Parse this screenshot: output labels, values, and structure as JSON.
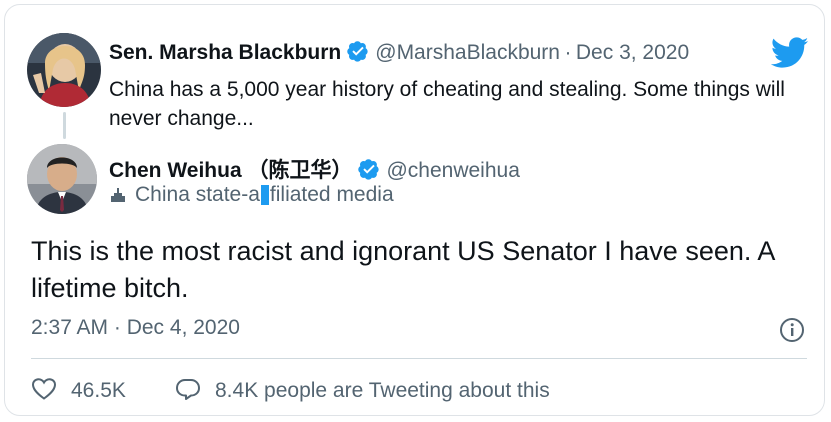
{
  "quoted_tweet": {
    "author_name": "Sen. Marsha Blackburn",
    "handle": "@MarshaBlackburn",
    "separator": "·",
    "date": "Dec 3, 2020",
    "text": "China has a 5,000 year history of cheating and stealing. Some things will never change..."
  },
  "tweet": {
    "author_name": "Chen Weihua （陈卫华）",
    "handle": "@chenweihua",
    "affiliation_before": "China state-a",
    "affiliation_after": "filiated media",
    "text": "This is the most racist and ignorant US Senator I have seen.  A lifetime bitch.",
    "timestamp": "2:37 AM · Dec 4, 2020",
    "likes": "46.5K",
    "tweeting_text": "8.4K people are Tweeting about this"
  },
  "icons": {
    "verified": "verified-badge-icon",
    "brand": "twitter-bird-icon",
    "info": "info-icon",
    "like": "heart-icon",
    "reply": "speech-bubble-icon",
    "affiliation": "podium-icon"
  },
  "colors": {
    "brand_blue": "#1d9bf0",
    "text_primary": "#0f1419",
    "text_secondary": "#536471"
  }
}
